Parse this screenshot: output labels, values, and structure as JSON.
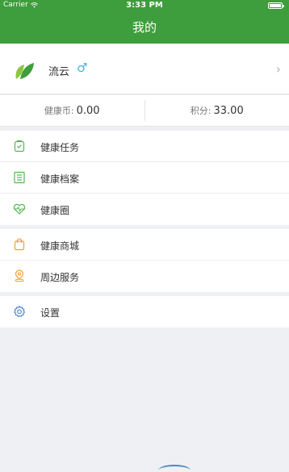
{
  "status_bar": {
    "carrier": "Carrier",
    "time": "3:33 PM"
  },
  "nav": {
    "title": "我的"
  },
  "profile": {
    "name": "流云",
    "gender_symbol": "♂",
    "chevron": "›"
  },
  "stats": {
    "coins_label": "健康币:",
    "coins_value": "0.00",
    "points_label": "积分:",
    "points_value": "33.00"
  },
  "menu_groups": [
    [
      {
        "label": "健康任务",
        "icon": "task-icon"
      },
      {
        "label": "健康档案",
        "icon": "record-icon"
      },
      {
        "label": "健康圈",
        "icon": "heart-pulse-icon"
      }
    ],
    [
      {
        "label": "健康商城",
        "icon": "shopping-bag-icon"
      },
      {
        "label": "周边服务",
        "icon": "location-pin-icon"
      }
    ],
    [
      {
        "label": "设置",
        "icon": "gear-icon"
      }
    ]
  ],
  "colors": {
    "header_green": "#3e9d3c",
    "icon_green": "#57b554",
    "icon_orange": "#eba335",
    "icon_blue": "#4a84c5",
    "gender_blue": "#4bb0e4",
    "background": "#eff0f4"
  }
}
